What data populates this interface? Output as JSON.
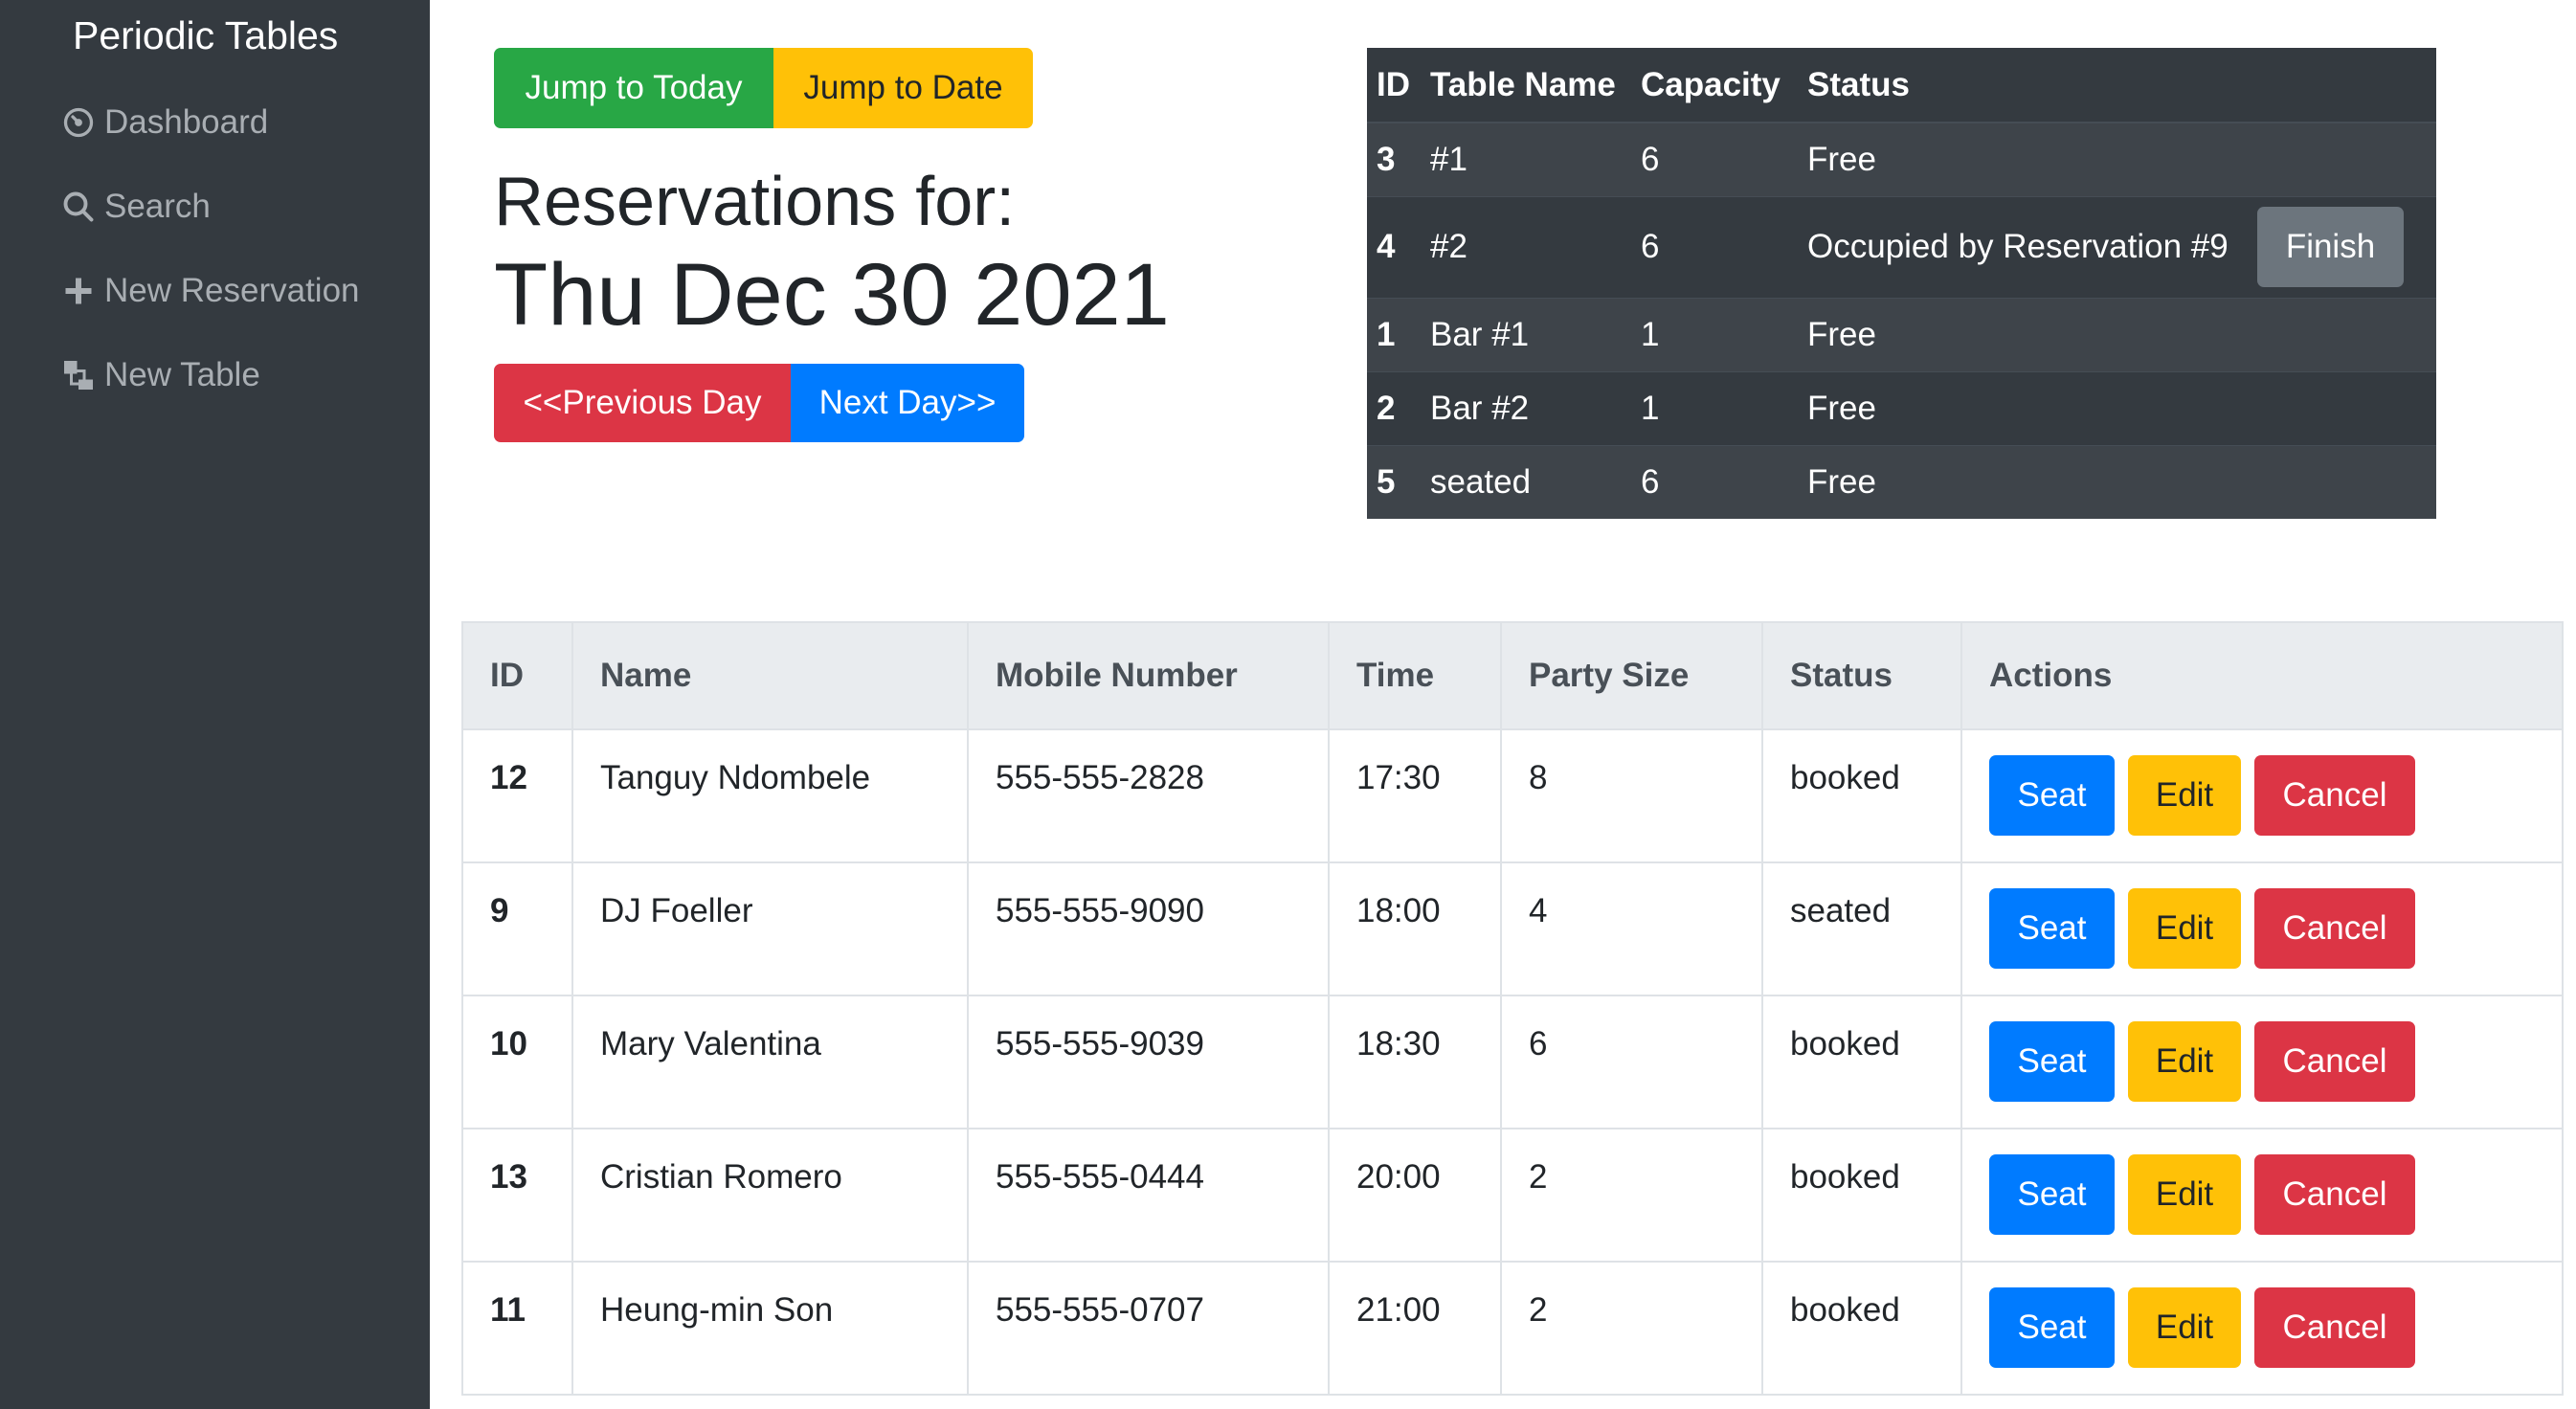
{
  "sidebar": {
    "brand": "Periodic Tables",
    "items": [
      {
        "label": "Dashboard",
        "icon": "dashboard-icon"
      },
      {
        "label": "Search",
        "icon": "search-icon"
      },
      {
        "label": "New Reservation",
        "icon": "plus-icon"
      },
      {
        "label": "New Table",
        "icon": "layers-icon"
      }
    ]
  },
  "toolbar": {
    "jump_today": "Jump to Today",
    "jump_date": "Jump to Date",
    "prev_day": "<<Previous Day",
    "next_day": "Next Day>>"
  },
  "heading": {
    "label": "Reservations for:",
    "date": "Thu Dec 30 2021"
  },
  "tables": {
    "headers": [
      "ID",
      "Table Name",
      "Capacity",
      "Status"
    ],
    "rows": [
      {
        "id": "3",
        "name": "#1",
        "capacity": "6",
        "status": "Free",
        "action": ""
      },
      {
        "id": "4",
        "name": "#2",
        "capacity": "6",
        "status": "Occupied by Reservation #9",
        "action": "Finish"
      },
      {
        "id": "1",
        "name": "Bar #1",
        "capacity": "1",
        "status": "Free",
        "action": ""
      },
      {
        "id": "2",
        "name": "Bar #2",
        "capacity": "1",
        "status": "Free",
        "action": ""
      },
      {
        "id": "5",
        "name": "seated",
        "capacity": "6",
        "status": "Free",
        "action": ""
      }
    ]
  },
  "reservations": {
    "headers": [
      "ID",
      "Name",
      "Mobile Number",
      "Time",
      "Party Size",
      "Status",
      "Actions"
    ],
    "action_labels": {
      "seat": "Seat",
      "edit": "Edit",
      "cancel": "Cancel"
    },
    "rows": [
      {
        "id": "12",
        "name": "Tanguy Ndombele",
        "mobile": "555-555-2828",
        "time": "17:30",
        "party": "8",
        "status": "booked"
      },
      {
        "id": "9",
        "name": "DJ Foeller",
        "mobile": "555-555-9090",
        "time": "18:00",
        "party": "4",
        "status": "seated"
      },
      {
        "id": "10",
        "name": "Mary Valentina",
        "mobile": "555-555-9039",
        "time": "18:30",
        "party": "6",
        "status": "booked"
      },
      {
        "id": "13",
        "name": "Cristian Romero",
        "mobile": "555-555-0444",
        "time": "20:00",
        "party": "2",
        "status": "booked"
      },
      {
        "id": "11",
        "name": "Heung-min Son",
        "mobile": "555-555-0707",
        "time": "21:00",
        "party": "2",
        "status": "booked"
      }
    ]
  },
  "colors": {
    "sidebar_bg": "#343a40",
    "success": "#28a745",
    "warning": "#ffc107",
    "danger": "#dc3545",
    "primary": "#007bff",
    "secondary": "#6c757d"
  }
}
